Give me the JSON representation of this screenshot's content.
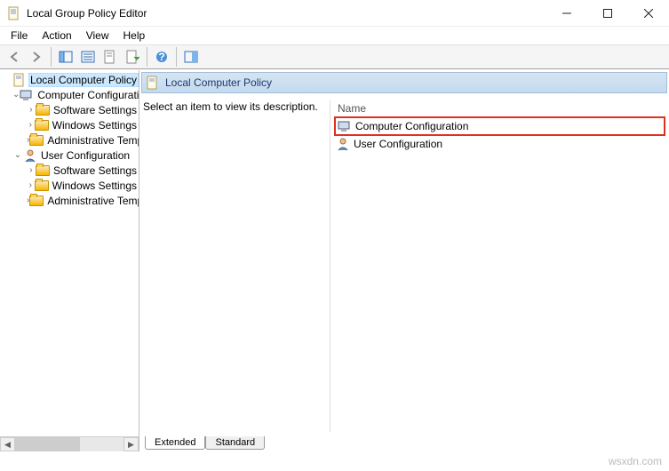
{
  "window": {
    "title": "Local Group Policy Editor"
  },
  "menu": {
    "file": "File",
    "action": "Action",
    "view": "View",
    "help": "Help"
  },
  "tree": {
    "root": "Local Computer Policy",
    "comp": "Computer Configuration",
    "user": "User Configuration",
    "sw": "Software Settings",
    "win": "Windows Settings",
    "admin": "Administrative Templates"
  },
  "header": {
    "title": "Local Computer Policy"
  },
  "body": {
    "desc": "Select an item to view its description.",
    "colName": "Name",
    "item1": "Computer Configuration",
    "item2": "User Configuration"
  },
  "tabs": {
    "extended": "Extended",
    "standard": "Standard"
  },
  "watermark": "wsxdn.com"
}
